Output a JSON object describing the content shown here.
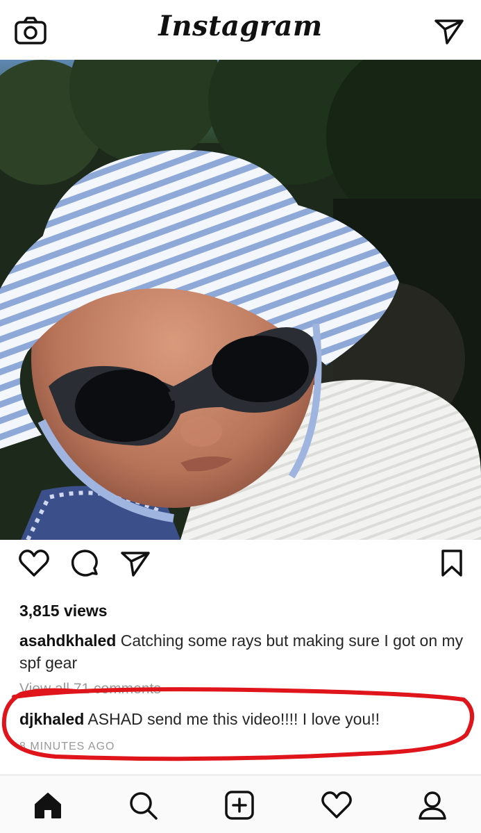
{
  "header": {
    "logo_text": "Instagram",
    "camera_icon": "camera-icon",
    "direct_icon": "paper-plane-icon"
  },
  "post": {
    "image_description_icon": "photo",
    "actions": {
      "like_icon": "heart-icon",
      "comment_icon": "comment-icon",
      "share_icon": "paper-plane-icon",
      "save_icon": "bookmark-icon"
    },
    "views": "3,815 views",
    "caption_user": "asahdkhaled",
    "caption_text": " Catching some rays but making sure I got on my spf gear",
    "view_all": "View all 71 comments",
    "comment_user": "djkhaled",
    "comment_text": " ASHAD send me this video!!!! I love you!!",
    "time_ago": "8 MINUTES AGO"
  },
  "annotation": {
    "color": "#e0141b"
  },
  "nav": {
    "home_icon": "home-icon",
    "search_icon": "search-icon",
    "add_icon": "add-icon",
    "activity_icon": "heart-icon",
    "profile_icon": "profile-icon"
  }
}
